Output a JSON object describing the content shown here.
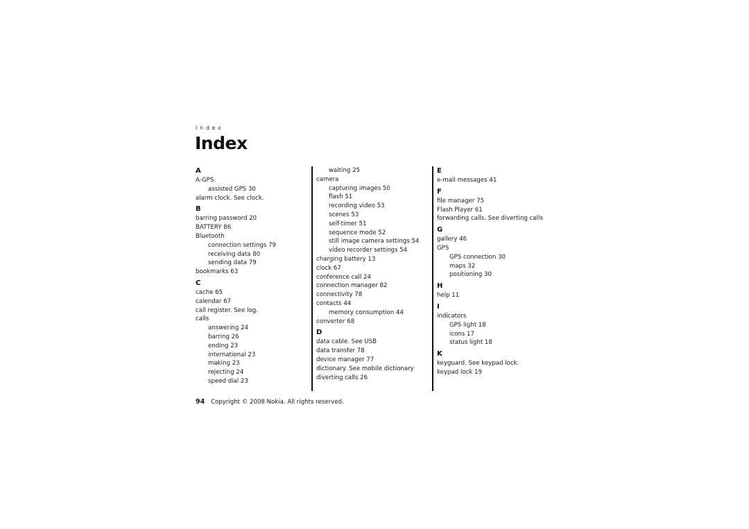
{
  "running_head": "Index",
  "title": "Index",
  "columns": [
    [
      {
        "type": "letter",
        "text": "A"
      },
      {
        "type": "entry",
        "text": "A-GPS"
      },
      {
        "type": "sub",
        "text": "assisted GPS  30"
      },
      {
        "type": "entry",
        "text": "alarm clock. See clock."
      },
      {
        "type": "letter",
        "text": "B"
      },
      {
        "type": "entry",
        "text": "barring password  20"
      },
      {
        "type": "entry",
        "text": "BATTERY  86"
      },
      {
        "type": "entry",
        "text": "Bluetooth"
      },
      {
        "type": "sub",
        "text": "connection settings  79"
      },
      {
        "type": "sub",
        "text": "receiving data  80"
      },
      {
        "type": "sub",
        "text": "sending data  79"
      },
      {
        "type": "entry",
        "text": "bookmarks  63"
      },
      {
        "type": "letter",
        "text": "C"
      },
      {
        "type": "entry",
        "text": "cache  65"
      },
      {
        "type": "entry",
        "text": "calendar  67"
      },
      {
        "type": "entry",
        "text": "call register. See log."
      },
      {
        "type": "entry",
        "text": "calls"
      },
      {
        "type": "sub",
        "text": "answering  24"
      },
      {
        "type": "sub",
        "text": "barring  26"
      },
      {
        "type": "sub",
        "text": "ending  23"
      },
      {
        "type": "sub",
        "text": "international  23"
      },
      {
        "type": "sub",
        "text": "making  23"
      },
      {
        "type": "sub",
        "text": "rejecting  24"
      },
      {
        "type": "sub",
        "text": "speed dial  23"
      }
    ],
    [
      {
        "type": "sub",
        "text": "waiting  25"
      },
      {
        "type": "entry",
        "text": "camera"
      },
      {
        "type": "sub",
        "text": "capturing images  50"
      },
      {
        "type": "sub",
        "text": "flash  51"
      },
      {
        "type": "sub",
        "text": "recording video  53"
      },
      {
        "type": "sub",
        "text": "scenes  53"
      },
      {
        "type": "sub",
        "text": "self-timer  51"
      },
      {
        "type": "sub",
        "text": "sequence mode  52"
      },
      {
        "type": "sub",
        "text": "still image camera settings  54"
      },
      {
        "type": "sub",
        "text": "video recorder settings  54"
      },
      {
        "type": "entry",
        "text": "charging battery  13"
      },
      {
        "type": "entry",
        "text": "clock  67"
      },
      {
        "type": "entry",
        "text": "conference call  24"
      },
      {
        "type": "entry",
        "text": "connection manager  82"
      },
      {
        "type": "entry",
        "text": "connectivity  78"
      },
      {
        "type": "entry",
        "text": "contacts  44"
      },
      {
        "type": "sub",
        "text": "memory consumption  44"
      },
      {
        "type": "entry",
        "text": "converter  68"
      },
      {
        "type": "letter",
        "text": "D"
      },
      {
        "type": "entry",
        "text": "data cable. See USB"
      },
      {
        "type": "entry",
        "text": "data transfer  78"
      },
      {
        "type": "entry",
        "text": "device manager  77"
      },
      {
        "type": "entry",
        "text": "dictionary. See mobile dictionary"
      },
      {
        "type": "entry",
        "text": "diverting calls  26"
      }
    ],
    [
      {
        "type": "letter",
        "text": "E"
      },
      {
        "type": "entry",
        "text": "e-mail messages  41"
      },
      {
        "type": "letter",
        "text": "F"
      },
      {
        "type": "entry",
        "text": "file manager  75"
      },
      {
        "type": "entry",
        "text": "Flash Player  61"
      },
      {
        "type": "entry",
        "text": "forwarding calls. See diverting calls"
      },
      {
        "type": "letter",
        "text": "G"
      },
      {
        "type": "entry",
        "text": "gallery  46"
      },
      {
        "type": "entry",
        "text": "GPS"
      },
      {
        "type": "sub",
        "text": "GPS connection  30"
      },
      {
        "type": "sub",
        "text": "maps  32"
      },
      {
        "type": "sub",
        "text": "positioning  30"
      },
      {
        "type": "letter",
        "text": "H"
      },
      {
        "type": "entry",
        "text": "help  11"
      },
      {
        "type": "letter",
        "text": "I"
      },
      {
        "type": "entry",
        "text": "indicators"
      },
      {
        "type": "sub",
        "text": "GPS light  18"
      },
      {
        "type": "sub",
        "text": "icons  17"
      },
      {
        "type": "sub",
        "text": "status light  18"
      },
      {
        "type": "letter",
        "text": "K"
      },
      {
        "type": "entry",
        "text": "keyguard. See keypad lock."
      },
      {
        "type": "entry",
        "text": "keypad lock  19"
      }
    ]
  ],
  "footer": {
    "page_number": "94",
    "copyright": "Copyright © 2008 Nokia. All rights reserved."
  }
}
